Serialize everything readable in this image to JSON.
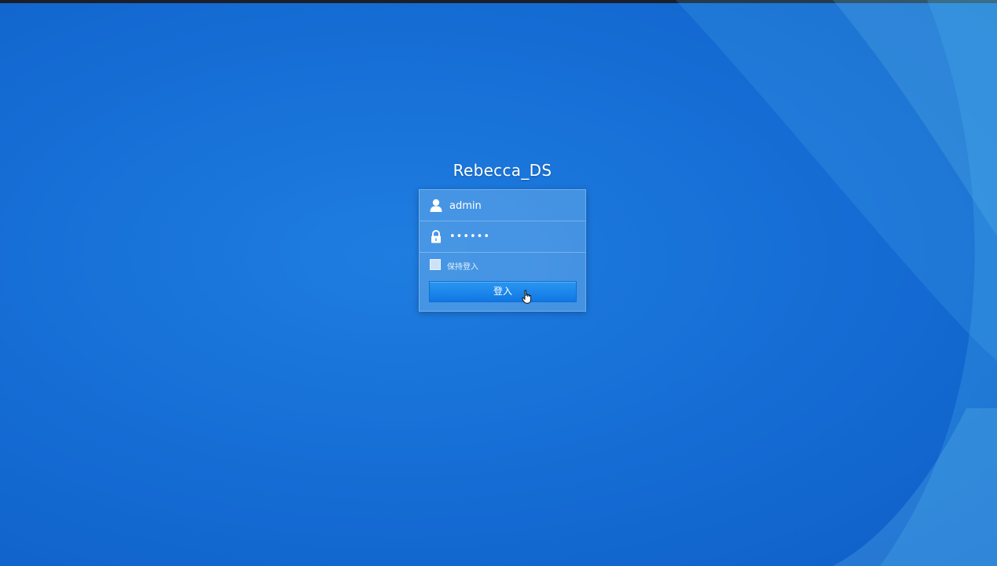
{
  "login": {
    "server_name": "Rebecca_DS",
    "username_value": "admin",
    "password_value": "••••••",
    "remember_label": "保持登入",
    "submit_label": "登入"
  },
  "icons": {
    "user": "user-icon",
    "lock": "lock-icon",
    "cursor": "hand-pointer-icon"
  },
  "colors": {
    "background": "#166fd6",
    "button": "#1a86ea",
    "text": "#ffffff"
  }
}
